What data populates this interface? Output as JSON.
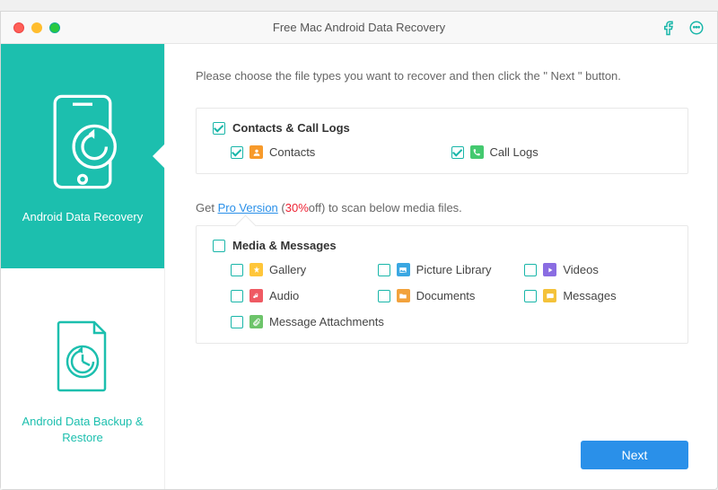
{
  "window": {
    "title": "Free Mac Android Data Recovery"
  },
  "sidebar": {
    "items": [
      {
        "label": "Android Data Recovery"
      },
      {
        "label": "Android Data Backup & Restore"
      }
    ]
  },
  "instruction": "Please choose the file types you want to recover and then click the \" Next \" button.",
  "group1": {
    "title": "Contacts & Call Logs",
    "items": [
      {
        "label": "Contacts"
      },
      {
        "label": "Call Logs"
      }
    ]
  },
  "promo": {
    "prefix": "Get ",
    "link": "Pro Version",
    "discount": "30%",
    "off": "off",
    "suffix": ") to scan below media files."
  },
  "group2": {
    "title": "Media & Messages",
    "items": [
      {
        "label": "Gallery"
      },
      {
        "label": "Picture Library"
      },
      {
        "label": "Videos"
      },
      {
        "label": "Audio"
      },
      {
        "label": "Documents"
      },
      {
        "label": "Messages"
      },
      {
        "label": "Message Attachments"
      }
    ]
  },
  "buttons": {
    "next": "Next"
  }
}
